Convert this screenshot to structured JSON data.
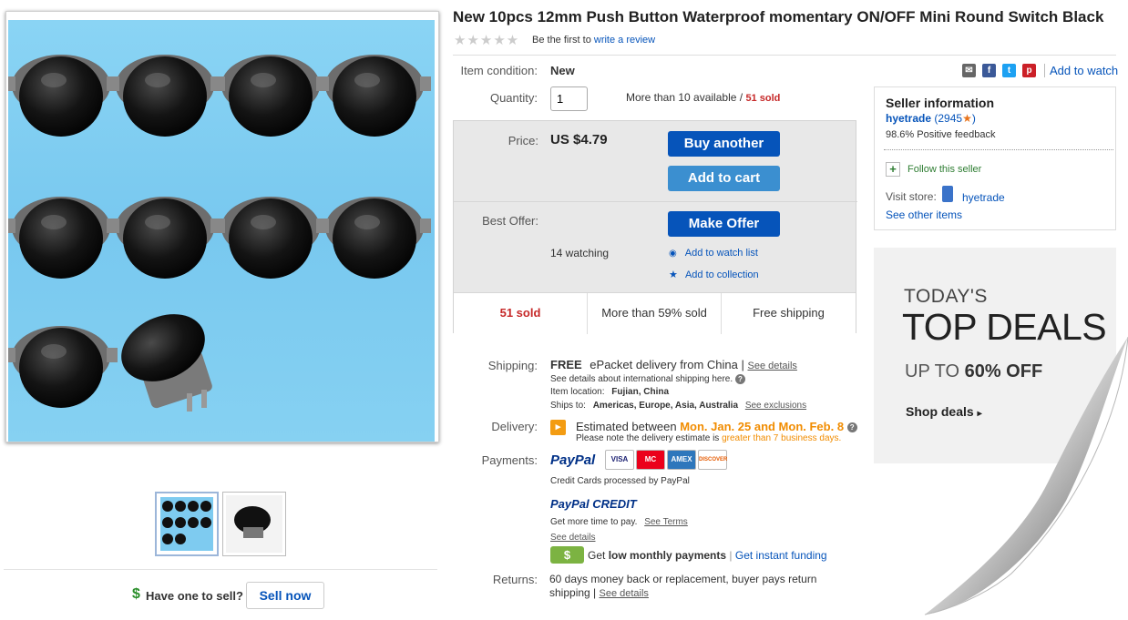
{
  "listing": {
    "title": "New 10pcs 12mm Push Button Waterproof momentary ON/OFF Mini Round Switch Black",
    "review_prefix": "Be the first to",
    "review_link": "write a review"
  },
  "details": {
    "condition_label": "Item condition:",
    "condition_value": "New",
    "quantity_label": "Quantity:",
    "quantity_value": "1",
    "availability": "More than 10 available /",
    "sold_count": "51 sold"
  },
  "share": {
    "add_to_watch": "Add to watch",
    "icons": [
      "email-icon",
      "facebook-icon",
      "twitter-icon",
      "pinterest-icon"
    ]
  },
  "price_box": {
    "price_label": "Price:",
    "price_value": "US $4.79",
    "buy_button": "Buy another",
    "cart_button": "Add to cart",
    "offer_label": "Best Offer:",
    "offer_button": "Make Offer",
    "watching": "14 watching",
    "watch_link": "Add to watch list",
    "collection_link": "Add to collection",
    "stats": [
      "51 sold",
      "More than 59% sold",
      "Free shipping"
    ]
  },
  "shipping": {
    "label": "Shipping:",
    "free": "FREE",
    "method": "ePacket delivery from China |",
    "see_details": "See details",
    "intl_note": "See details about international shipping here.",
    "location_label": "Item location:",
    "location_value": "Fujian, China",
    "ships_label": "Ships to:",
    "ships_value": "Americas, Europe, Asia, Australia",
    "exclusions": "See exclusions"
  },
  "delivery": {
    "label": "Delivery:",
    "estimate_prefix": "Estimated between",
    "estimate_dates": "Mon. Jan. 25 and Mon. Feb. 8",
    "note_prefix": "Please note the delivery estimate is",
    "note_highlight": "greater than 7 business days."
  },
  "payments": {
    "label": "Payments:",
    "paypal": "PayPal",
    "cards": [
      "VISA",
      "MC",
      "AMEX",
      "DISCOVER"
    ],
    "cc_note": "Credit Cards processed by PayPal",
    "credit_brand": "PayPal CREDIT",
    "credit_note": "Get more time to pay.",
    "see_terms": "See Terms",
    "see_details": "See details",
    "monthly_prefix": "Get",
    "monthly_bold": "low monthly payments",
    "funding_link": "Get instant funding"
  },
  "returns": {
    "label": "Returns:",
    "line1": "60 days money back or replacement, buyer pays return",
    "line2": "shipping |",
    "see_details": "See details"
  },
  "seller": {
    "heading": "Seller information",
    "name": "hyetrade",
    "score": "(2945",
    "score_close": ")",
    "feedback": "98.6% Positive feedback",
    "follow": "Follow this seller",
    "visit_label": "Visit store:",
    "store_name": "hyetrade",
    "other_items": "See other items"
  },
  "deals": {
    "line1": "TODAY'S",
    "line2": "TOP DEALS",
    "line3_prefix": "UP TO",
    "line3_bold": "60% OFF",
    "cta": "Shop deals"
  },
  "sell": {
    "question": "Have one to sell?",
    "button": "Sell now"
  },
  "colors": {
    "link": "#0654ba",
    "button_dark": "#0654ba",
    "button_light": "#3b8fd0",
    "sold_red": "#c62828",
    "delivery_orange": "#f18c00"
  }
}
